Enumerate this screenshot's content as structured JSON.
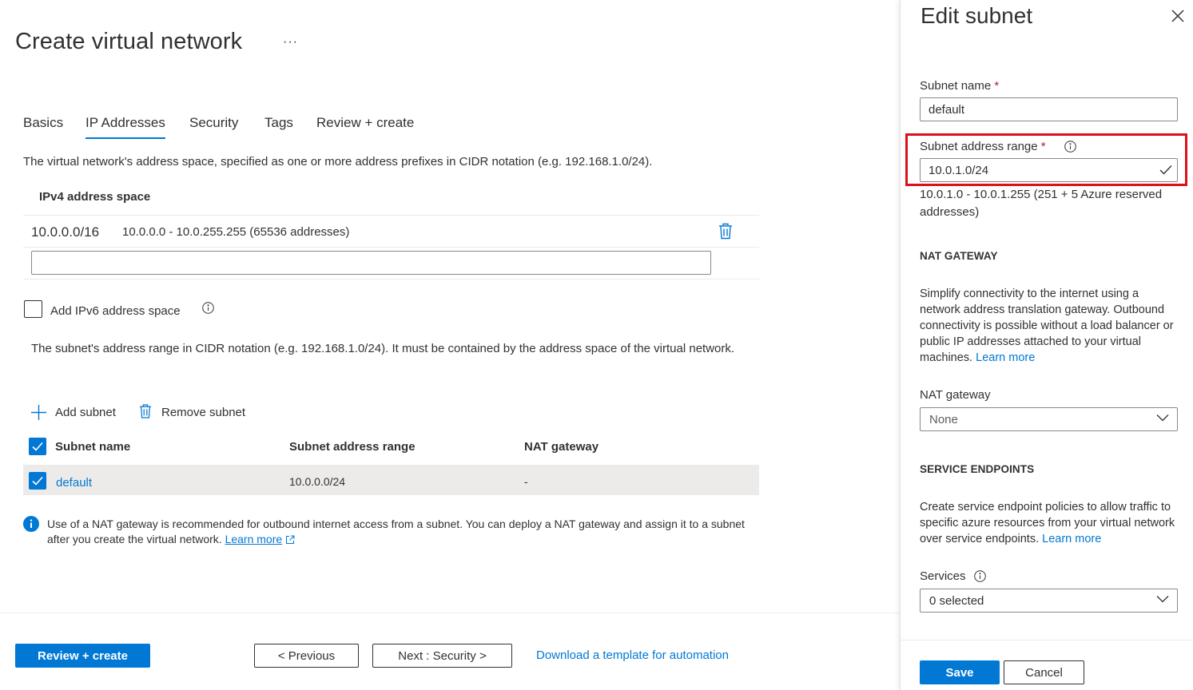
{
  "page": {
    "title": "Create virtual network",
    "more": "···"
  },
  "tabs": [
    {
      "label": "Basics"
    },
    {
      "label": "IP Addresses"
    },
    {
      "label": "Security"
    },
    {
      "label": "Tags"
    },
    {
      "label": "Review + create"
    }
  ],
  "address_space": {
    "description": "The virtual network's address space, specified as one or more address prefixes in CIDR notation (e.g. 192.168.1.0/24).",
    "header": "IPv4 address space",
    "entries": [
      {
        "prefix": "10.0.0.0/16",
        "range": "10.0.0.0 - 10.0.255.255 (65536 addresses)"
      }
    ],
    "new_value": "",
    "ipv6_label": "Add IPv6 address space"
  },
  "subnets": {
    "description": "The subnet's address range in CIDR notation (e.g. 192.168.1.0/24). It must be contained by the address space of the virtual network.",
    "add_label": "Add subnet",
    "remove_label": "Remove subnet",
    "columns": [
      "Subnet name",
      "Subnet address range",
      "NAT gateway"
    ],
    "rows": [
      {
        "name": "default",
        "range": "10.0.0.0/24",
        "nat": "-"
      }
    ],
    "info_text": "Use of a NAT gateway is recommended for outbound internet access from a subnet. You can deploy a NAT gateway and assign it to a subnet after you create the virtual network.",
    "info_link": "Learn more"
  },
  "footer": {
    "review_label": "Review + create",
    "previous_label": "< Previous",
    "next_label": "Next : Security >",
    "download_label": "Download a template for automation"
  },
  "panel": {
    "title": "Edit subnet",
    "subnet_name_label": "Subnet name",
    "required_mark": "*",
    "subnet_name_value": "default",
    "range_label": "Subnet address range",
    "range_value": "10.0.1.0/24",
    "range_hint": "10.0.1.0 - 10.0.1.255 (251 + 5 Azure reserved addresses)",
    "nat_heading": "NAT GATEWAY",
    "nat_desc": "Simplify connectivity to the internet using a network address translation gateway. Outbound connectivity is possible without a load balancer or public IP addresses attached to your virtual machines.",
    "learn_more": "Learn more",
    "nat_gateway_label": "NAT gateway",
    "nat_gateway_value": "None",
    "se_heading": "SERVICE ENDPOINTS",
    "se_desc": "Create service endpoint policies to allow traffic to specific azure resources from your virtual network over service endpoints.",
    "services_label": "Services",
    "services_value": "0 selected",
    "save_label": "Save",
    "cancel_label": "Cancel"
  },
  "colors": {
    "accent": "#0078d4",
    "highlight": "#d9111a",
    "required": "#a4262c"
  }
}
